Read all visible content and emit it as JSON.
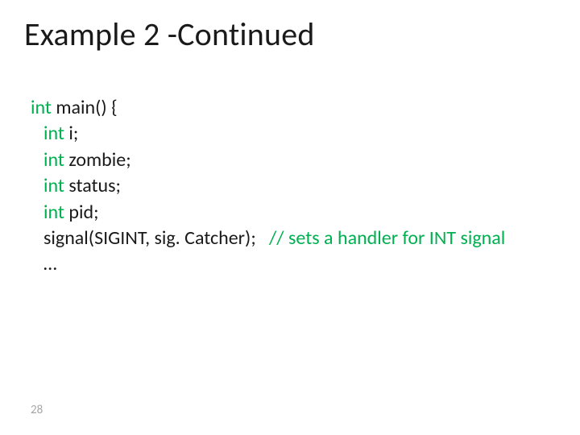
{
  "title": "Example 2 -Continued",
  "lines": {
    "l0_kw": "int",
    "l0_rest": " main() {",
    "l1_kw": "int",
    "l1_rest": " i;",
    "l2_kw": "int",
    "l2_rest": " zombie;",
    "l3_kw": "int",
    "l3_rest": " status;",
    "l4_kw": "int",
    "l4_rest": " pid;",
    "l5": "signal(SIGINT, sig. Catcher);   ",
    "l5_comment": "// sets a handler for INT signal",
    "l6": "…"
  },
  "page_number": "28"
}
